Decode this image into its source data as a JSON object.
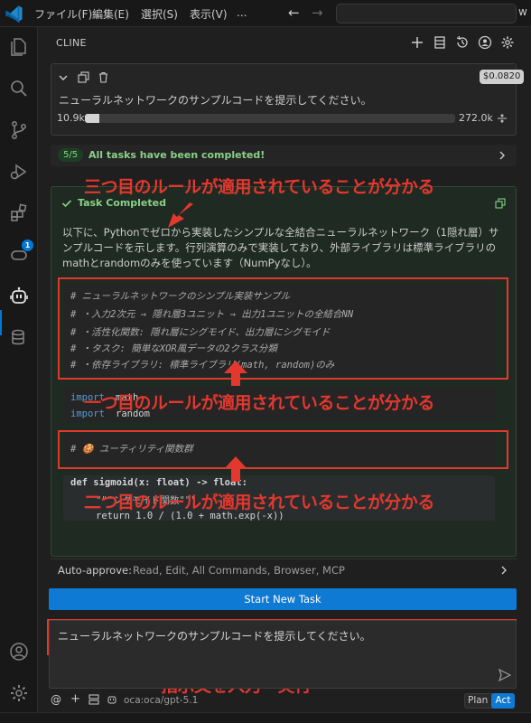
{
  "menu": {
    "items": [
      "ファイル(F)",
      "編集(E)",
      "選択(S)",
      "表示(V)",
      "..."
    ],
    "search_text": "w"
  },
  "panel": {
    "title": "CLINE"
  },
  "task": {
    "cost": "$0.0820",
    "text": "ニューラルネットワークのサンプルコードを提示してください。",
    "tokens_in": "10.9k",
    "tokens_max": "272.0k",
    "context_used_fraction": 0.04
  },
  "tasks_banner": {
    "count": "5/5",
    "text": "All tasks have been completed!"
  },
  "completion": {
    "title": "Task Completed",
    "intro": "以下に、Pythonでゼロから実装したシンプルな全結合ニューラルネットワーク（1隠れ層）サンプルコードを示します。行列演算のみで実装しており、外部ライブラリは標準ライブラリのmathとrandomのみを使っています（NumPyなし）。",
    "code_comments": [
      "# ニューラルネットワークのシンプル実装サンプル",
      "# ・入力2次元 → 隠れ層3ユニット → 出力1ユニットの全結合NN",
      "# ・活性化関数: 隠れ層にシグモイド、出力層にシグモイド",
      "# ・タスク: 簡単なXOR風データの2クラス分類",
      "# ・依存ライブラリ: 標準ライブラリ(math, random)のみ"
    ],
    "import_kw_1": "import",
    "import_mod_1": "math",
    "import_kw_2": "import",
    "import_mod_2": "random",
    "util_comment": "# 🍪 ユーティリティ関数群",
    "def_line": "def sigmoid(x: float) -> float:",
    "docstring": "\"\"\"シグモイド関数\"\"\"",
    "return_line": "return 1.0 / (1.0 + math.exp(-x))"
  },
  "annotations": {
    "third_rule": "三つ目のルールが適用されていることが分かる",
    "first_rule": "一つ目のルールが適用されていることが分かる",
    "second_rule": "二つ目のルールが適用されていることが分かる",
    "input_hint": "指示文を入力・実行"
  },
  "bottom": {
    "auto_approve_label": "Auto-approve:",
    "auto_approve_value": "Read, Edit, All Commands, Browser, MCP",
    "new_task_button": "Start New Task",
    "prompt_text": "ニューラルネットワークのサンプルコードを提示してください。",
    "model_name": "oca:oca/gpt-5.1",
    "mode_plan": "Plan",
    "mode_act": "Act"
  },
  "colors": {
    "accent": "#0e7ad4",
    "success": "#89d185",
    "annotation_red": "#e2382e"
  },
  "activity_badge": "1"
}
